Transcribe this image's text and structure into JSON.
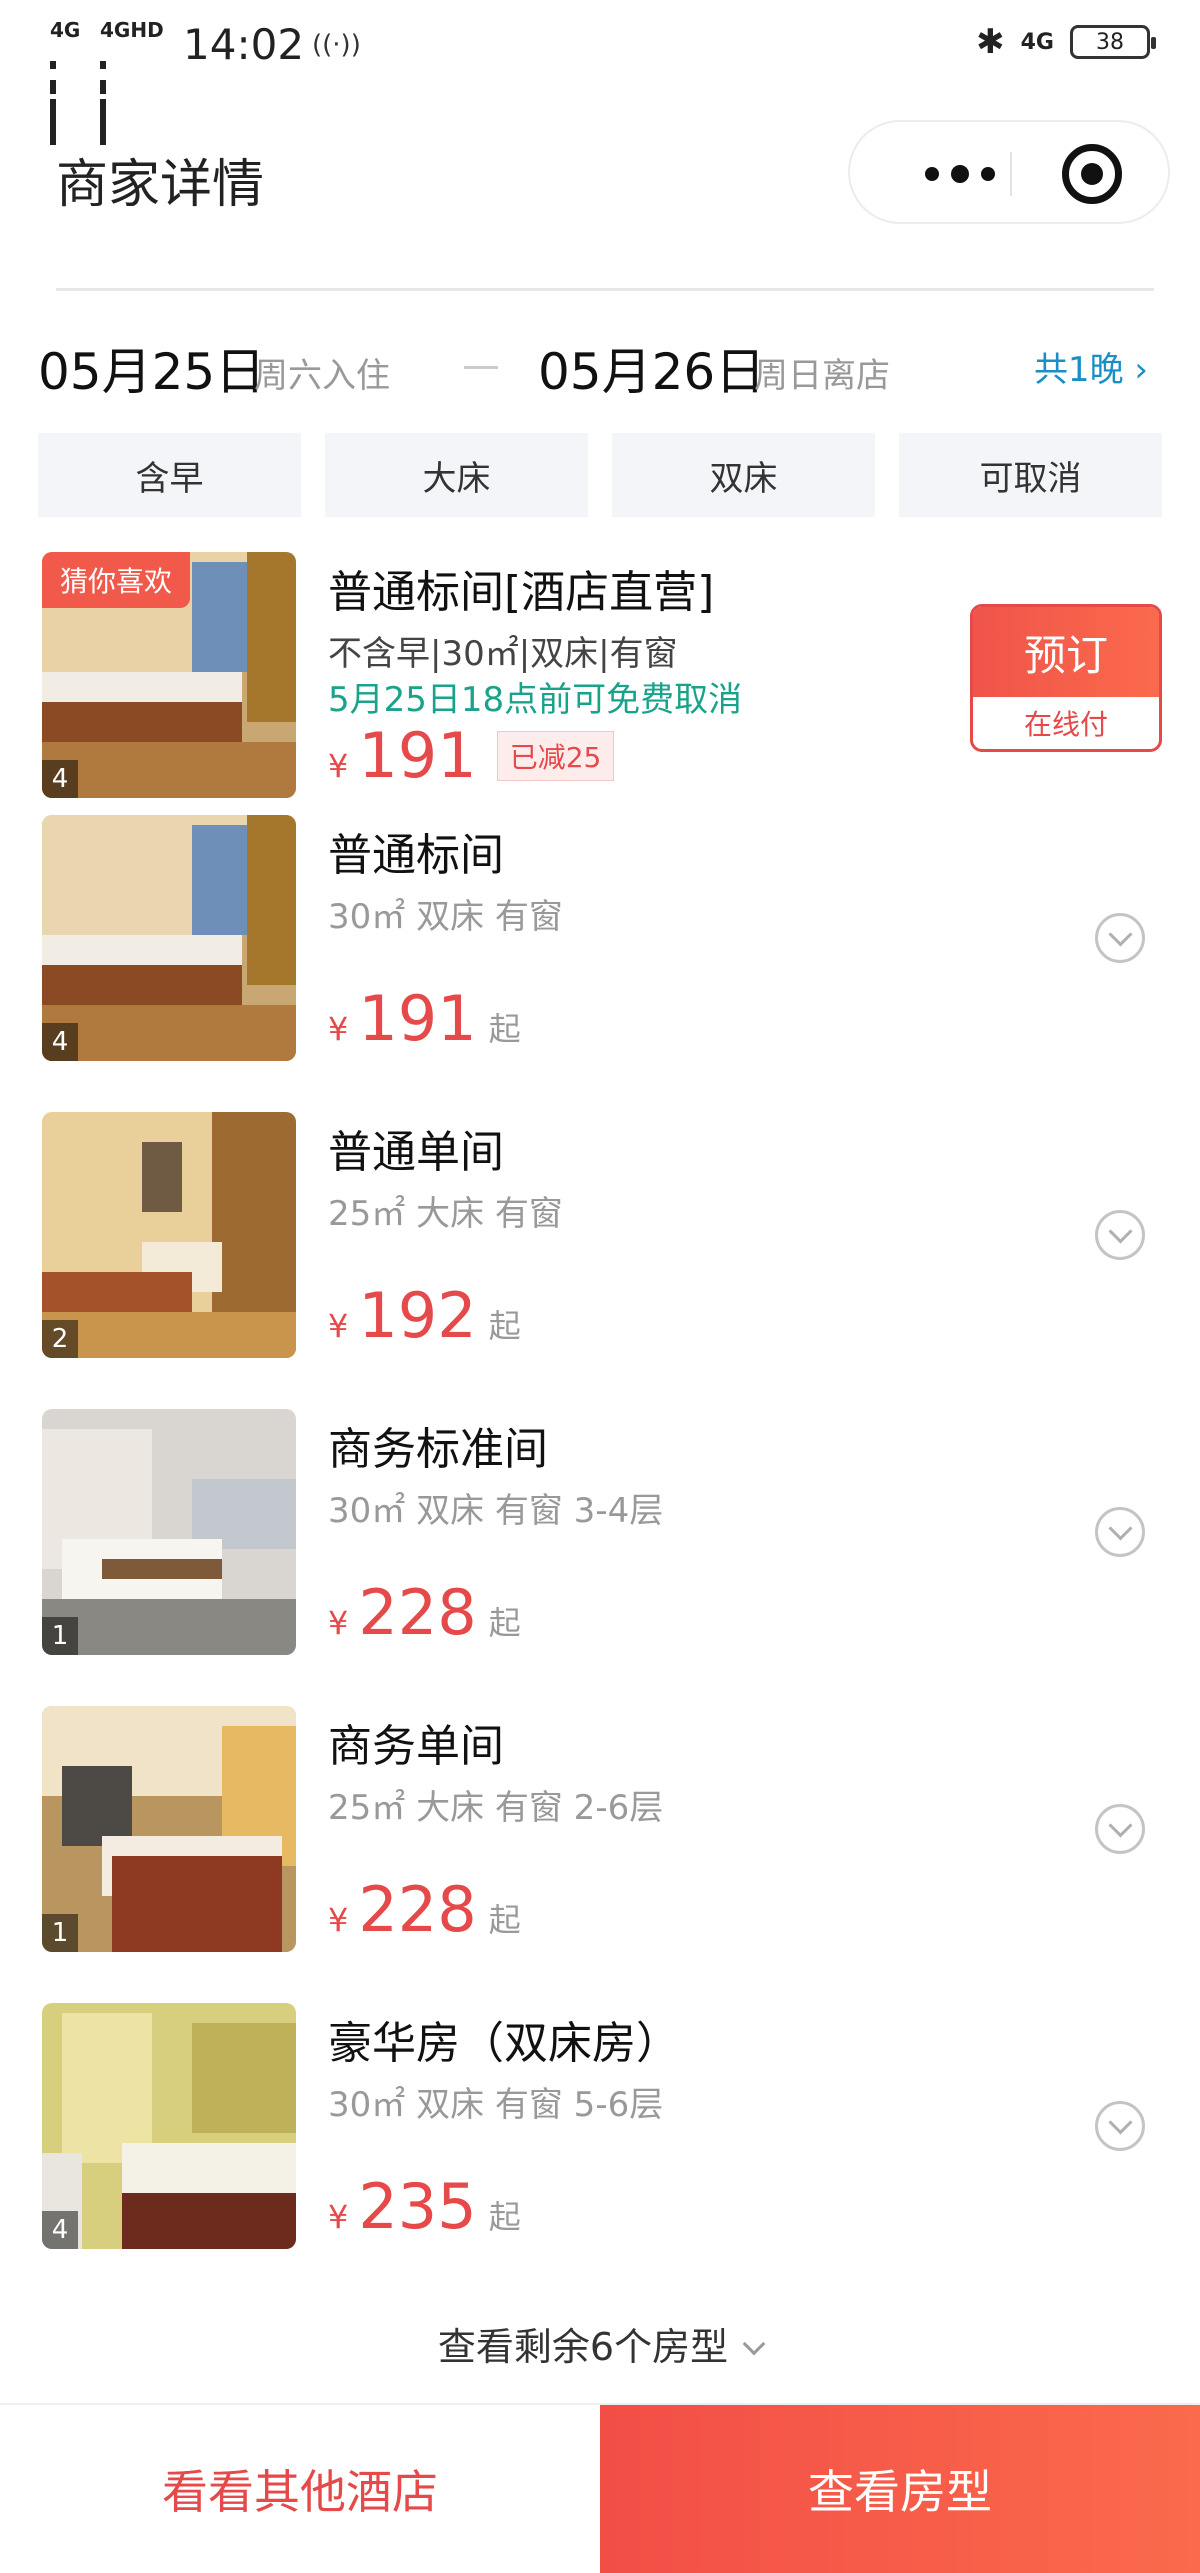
{
  "status_bar": {
    "net1": "4G",
    "net2": "4GHD",
    "time": "14:02",
    "net_right": "4G",
    "battery": "38"
  },
  "nav": {
    "title": "商家详情"
  },
  "dates": {
    "checkin_date": "05月25日",
    "checkin_label": "周六入住",
    "checkout_date": "05月26日",
    "checkout_label": "周日离店",
    "nights": "共1晚"
  },
  "filters": [
    "含早",
    "大床",
    "双床",
    "可取消"
  ],
  "rooms": [
    {
      "tag": "猜你喜欢",
      "name": "普通标间[酒店直营]",
      "spec": "不含早|30㎡|双床|有窗",
      "cancel": "5月25日18点前可免费取消",
      "yen": "¥",
      "price": "191",
      "discount": "已减25",
      "photo_count": "4",
      "book": "预订",
      "pay": "在线付"
    },
    {
      "name": "普通标间",
      "spec": "30㎡ 双床 有窗",
      "yen": "¥",
      "price": "191",
      "suffix": "起",
      "photo_count": "4"
    },
    {
      "name": "普通单间",
      "spec": "25㎡ 大床 有窗",
      "yen": "¥",
      "price": "192",
      "suffix": "起",
      "photo_count": "2"
    },
    {
      "name": "商务标准间",
      "spec": "30㎡ 双床 有窗 3-4层",
      "yen": "¥",
      "price": "228",
      "suffix": "起",
      "photo_count": "1"
    },
    {
      "name": "商务单间",
      "spec": "25㎡ 大床 有窗 2-6层",
      "yen": "¥",
      "price": "228",
      "suffix": "起",
      "photo_count": "1"
    },
    {
      "name": "豪华房（双床房）",
      "spec": "30㎡ 双床 有窗 5-6层",
      "yen": "¥",
      "price": "235",
      "suffix": "起",
      "photo_count": "4"
    }
  ],
  "more_rooms": "查看剩余6个房型",
  "footer": {
    "other_hotels": "看看其他酒店",
    "view_rooms": "查看房型"
  },
  "colors": {
    "accent_red": "#e6494a",
    "cancel_green": "#1aa28b",
    "link_blue": "#1a8fc6"
  }
}
